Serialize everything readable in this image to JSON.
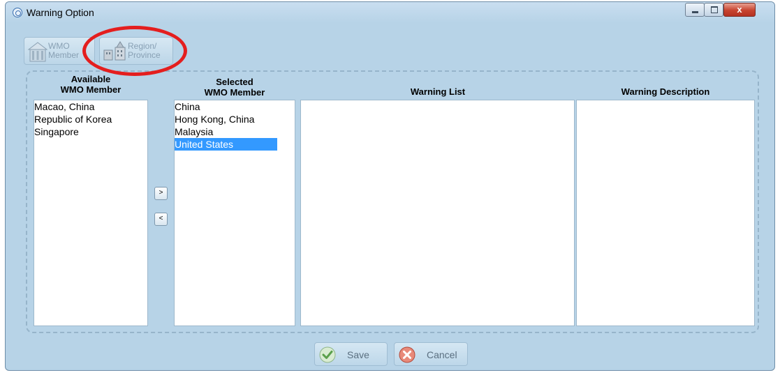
{
  "window": {
    "title": "Warning Option",
    "close_glyph": "x"
  },
  "toolbar": {
    "wmo_member_line1": "WMO",
    "wmo_member_line2": "Member",
    "region_line1": "Region/",
    "region_line2": "Province",
    "wmo_member_icon": "building-icon",
    "region_icon": "region-buildings-icon"
  },
  "columns": {
    "available_line1": "Available",
    "available_line2": "WMO Member",
    "selected_line1": "Selected",
    "selected_line2": "WMO Member",
    "warning_list": "Warning List",
    "warning_description": "Warning Description"
  },
  "available_members": [
    "Macao, China",
    "Republic of Korea",
    "Singapore"
  ],
  "selected_members": [
    "China",
    "Hong Kong, China",
    "Malaysia",
    "United States"
  ],
  "selected_highlight": "United States",
  "arrows": {
    "add": ">",
    "remove": "<"
  },
  "buttons": {
    "save": "Save",
    "cancel": "Cancel"
  },
  "colors": {
    "window_bg": "#b7d3e7",
    "selection": "#3399ff",
    "annotation_circle": "#e41e1e"
  }
}
